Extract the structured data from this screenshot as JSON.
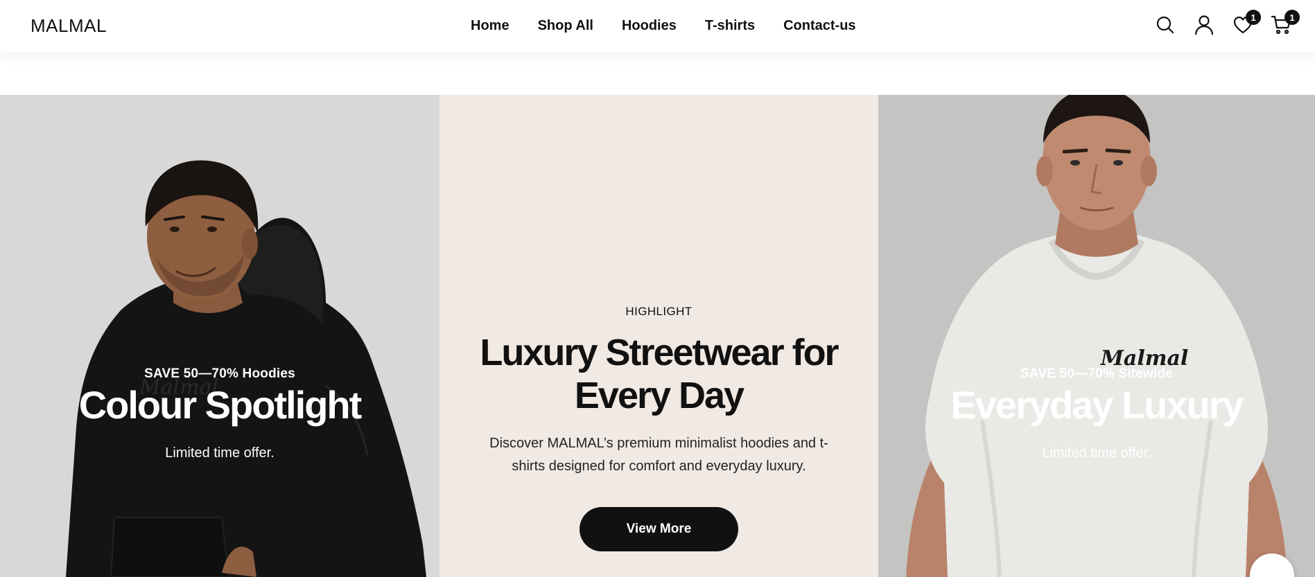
{
  "header": {
    "logo": "MALMAL",
    "nav": [
      "Home",
      "Shop All",
      "Hoodies",
      "T-shirts",
      "Contact-us"
    ],
    "wishlist_count": "1",
    "cart_count": "1",
    "icons": [
      "search-icon",
      "user-icon",
      "heart-icon",
      "cart-icon"
    ]
  },
  "hero": {
    "left": {
      "kicker": "SAVE 50—70% Hoodies",
      "title": "Colour Spotlight",
      "sub": "Limited time offer.",
      "print_logo": "Malmal"
    },
    "middle": {
      "kicker": "HIGHLIGHT",
      "title": "Luxury Streetwear for Every Day",
      "description": "Discover MALMAL’s premium minimalist hoodies and t-shirts designed for comfort and everyday luxury.",
      "button": "View More"
    },
    "right": {
      "kicker": "SAVE 50—70% Sitewide",
      "title": "Everyday Luxury",
      "sub": "Limited time offer.",
      "print_logo": "Malmal"
    }
  },
  "colors": {
    "accent": "#111111",
    "mid_panel_bg": "#f1e9e3",
    "left_panel_bg": "#d8d8d8",
    "right_panel_bg": "#c3c3c1"
  }
}
